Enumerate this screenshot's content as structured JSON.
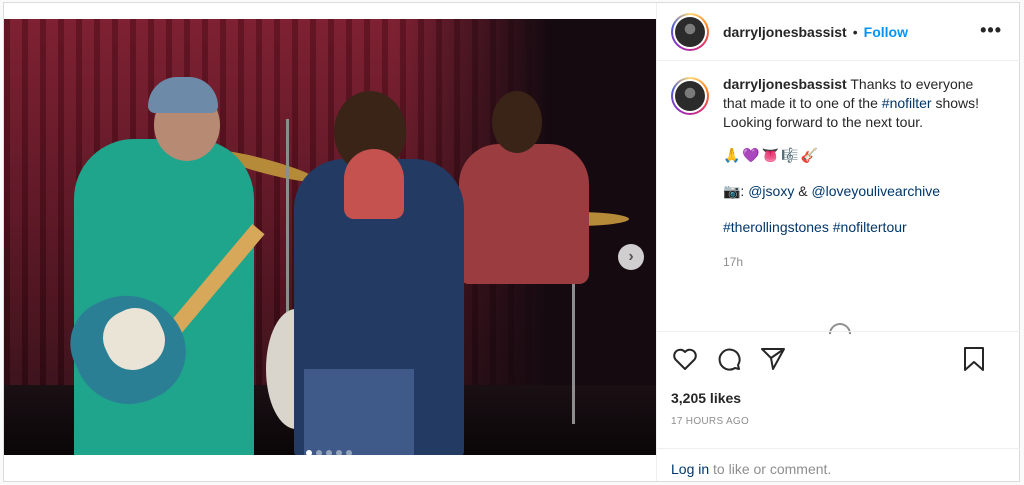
{
  "post": {
    "username": "darryljonesbassist",
    "separator": "•",
    "follow_label": "Follow",
    "more_icon": "more-options-icon",
    "more_glyph": "•••",
    "caption": {
      "username": "darryljonesbassist",
      "text_before": " Thanks to everyone that made it to one of the ",
      "hashtag_inline": "#nofilter",
      "text_after": " shows! Looking forward to the next tour.",
      "emojis": "🙏💜👅🎼🎸",
      "credit_prefix": "📷: ",
      "credit_user1": "@jsoxy",
      "credit_amp": " & ",
      "credit_user2": "@loveyoulivearchive",
      "tag1": "#therollingstones",
      "tag2": "#nofiltertour",
      "relative_time": "17h"
    },
    "likes": "3,205 likes",
    "posted_ago": "17 HOURS AGO",
    "login_link": "Log in",
    "login_rest": " to like or comment.",
    "carousel": {
      "next_glyph": "›",
      "slide_count": 5,
      "active_slide": 1
    }
  }
}
